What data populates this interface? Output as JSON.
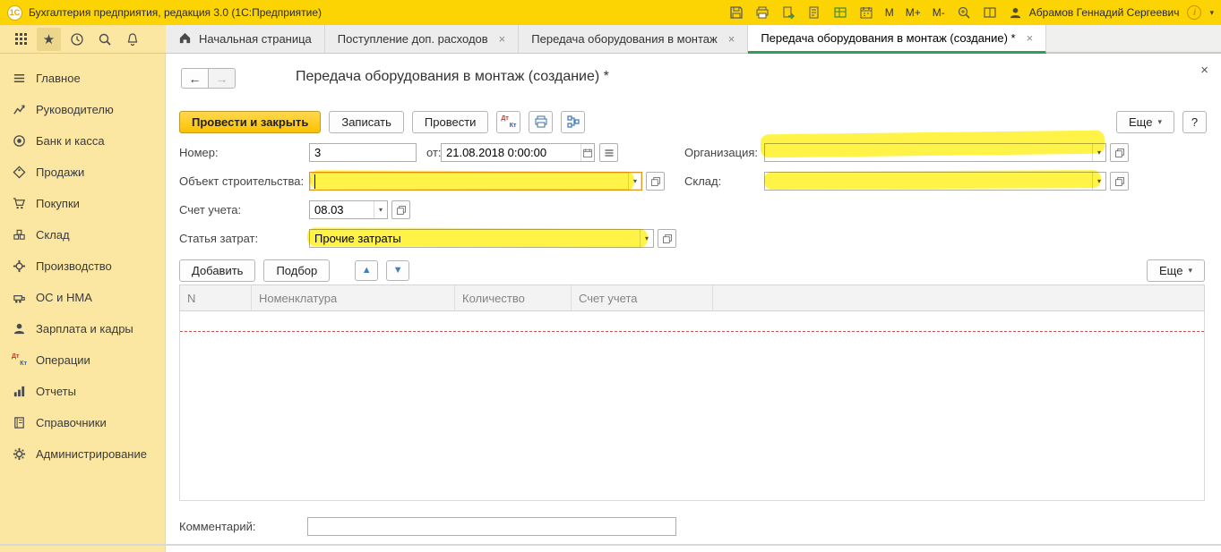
{
  "icons": {
    "logo": "1С",
    "close": "×",
    "chevron_down": "▾",
    "back_arrow": "←",
    "forward_arrow": "→",
    "star": "★",
    "dt": "Дт",
    "kt": "Кт",
    "info": "i",
    "up_arrow": "▲",
    "down_arrow": "▼"
  },
  "titlebar": {
    "title": "Бухгалтерия предприятия, редакция 3.0  (1С:Предприятие)",
    "memory": [
      "M",
      "M+",
      "M-"
    ],
    "user": "Абрамов Геннадий Сергеевич"
  },
  "tabs": {
    "home": "Начальная страница",
    "items": [
      {
        "label": "Поступление доп. расходов"
      },
      {
        "label": "Передача оборудования в монтаж"
      },
      {
        "label": "Передача оборудования в монтаж (создание) *"
      }
    ]
  },
  "sidebar": {
    "items": [
      "Главное",
      "Руководителю",
      "Банк и касса",
      "Продажи",
      "Покупки",
      "Склад",
      "Производство",
      "ОС и НМА",
      "Зарплата и кадры",
      "Операции",
      "Отчеты",
      "Справочники",
      "Администрирование"
    ]
  },
  "doc": {
    "title": "Передача оборудования в монтаж (создание) *",
    "toolbar": {
      "post_and_close": "Провести и закрыть",
      "write": "Записать",
      "post": "Провести",
      "more": "Еще",
      "help": "?"
    },
    "fields": {
      "number": {
        "label": "Номер:",
        "value": "3"
      },
      "date": {
        "label": "от:",
        "value": "21.08.2018 0:00:00"
      },
      "organization": {
        "label": "Организация:",
        "value": ""
      },
      "construction_object": {
        "label": "Объект строительства:",
        "value": ""
      },
      "warehouse": {
        "label": "Склад:",
        "value": ""
      },
      "account": {
        "label": "Счет учета:",
        "value": "08.03"
      },
      "cost_item": {
        "label": "Статья затрат:",
        "value": "Прочие затраты"
      },
      "comment": {
        "label": "Комментарий:",
        "value": ""
      }
    },
    "grid": {
      "add": "Добавить",
      "pick": "Подбор",
      "more": "Еще",
      "headers": [
        "N",
        "Номенклатура",
        "Количество",
        "Счет учета"
      ]
    }
  },
  "colors": {
    "titlebar": "#fcd303",
    "sidebar": "#fbe7a2",
    "active_tab_underline": "#2e9e5b",
    "primary_button": "#fcc200",
    "highlighter": "#ffee00"
  }
}
